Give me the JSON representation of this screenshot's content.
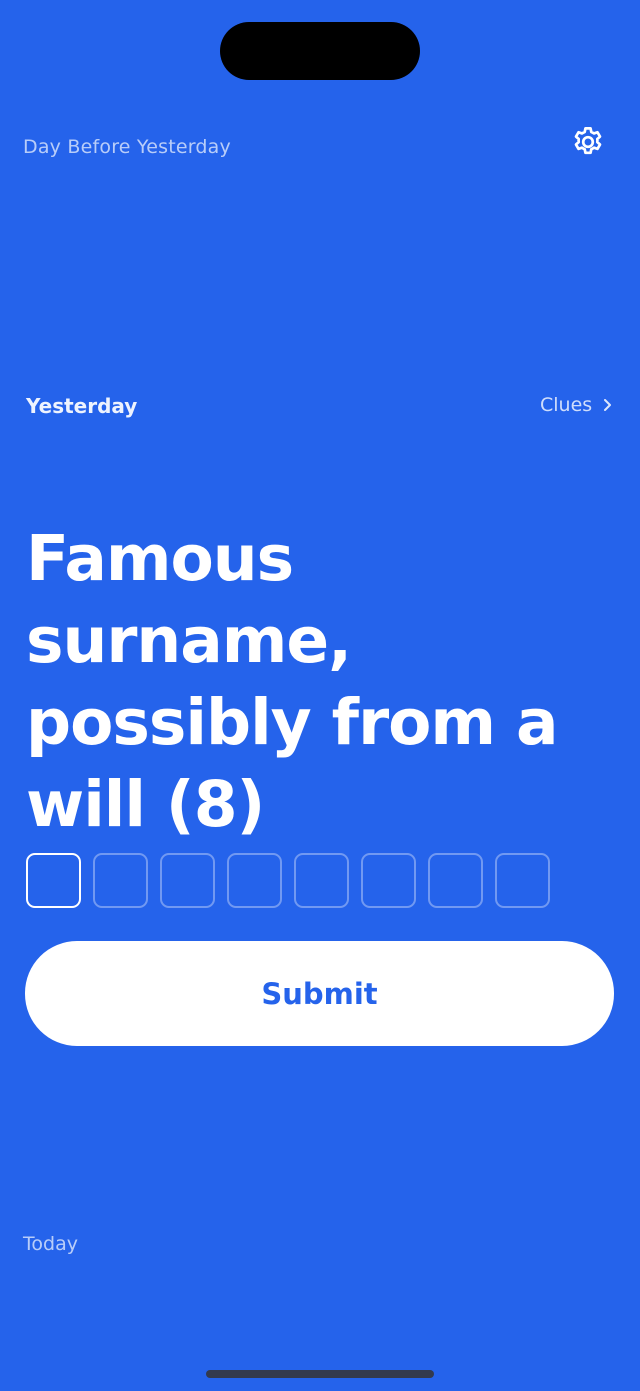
{
  "header": {
    "previous_day_label": "Day Before Yesterday",
    "settings_icon": "gear-icon"
  },
  "puzzle": {
    "day_label": "Yesterday",
    "clues_link_label": "Clues",
    "clues_link_icon": "chevron-right-icon",
    "clue_text": "Famous surname, possibly from a will (8)",
    "answer_length": 8,
    "active_box_index": 0,
    "submit_label": "Submit"
  },
  "footer": {
    "next_day_label": "Today"
  },
  "colors": {
    "background": "#2563eb",
    "button_bg": "#ffffff",
    "button_text": "#2563eb"
  }
}
